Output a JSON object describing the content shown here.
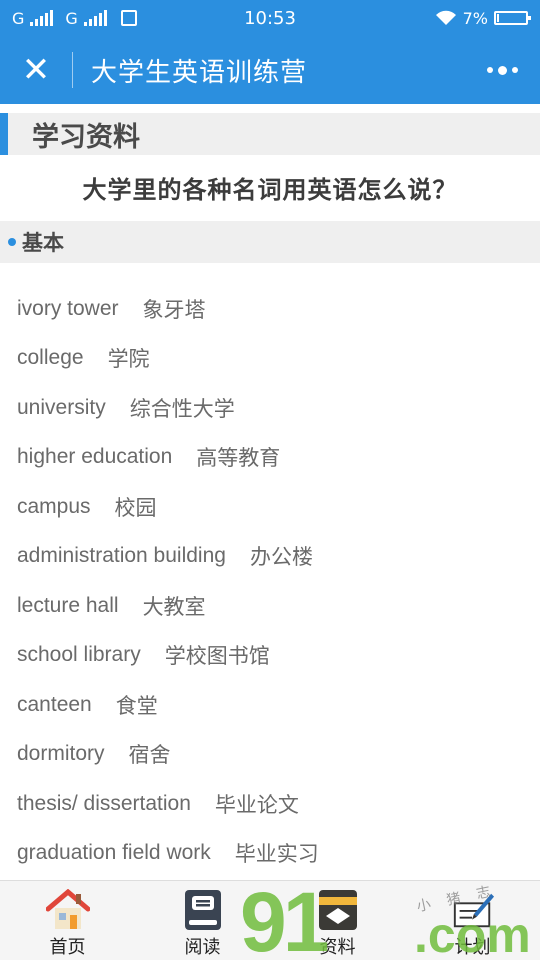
{
  "status_bar": {
    "carrier1": "G",
    "carrier2": "G",
    "time": "10:53",
    "battery_text": "7%",
    "battery_level": 0.07
  },
  "app_bar": {
    "close_label": "✕",
    "title": "大学生英语训练营"
  },
  "section": {
    "title": "学习资料"
  },
  "article": {
    "title": "大学里的各种名词用英语怎么说？"
  },
  "sub_section": {
    "title": "基本"
  },
  "vocab": [
    {
      "en": "ivory tower",
      "zh": "象牙塔"
    },
    {
      "en": "college",
      "zh": "学院"
    },
    {
      "en": "university",
      "zh": "综合性大学"
    },
    {
      "en": "higher education",
      "zh": "高等教育"
    },
    {
      "en": "campus",
      "zh": "校园"
    },
    {
      "en": "administration building",
      "zh": "办公楼"
    },
    {
      "en": "lecture hall",
      "zh": "大教室"
    },
    {
      "en": "school library",
      "zh": "学校图书馆"
    },
    {
      "en": "canteen",
      "zh": "食堂"
    },
    {
      "en": "dormitory",
      "zh": "宿舍"
    },
    {
      "en": "thesis/ dissertation",
      "zh": "毕业论文"
    },
    {
      "en": "graduation field work",
      "zh": "毕业实习"
    }
  ],
  "bottom_nav": {
    "items": [
      {
        "label": "首页",
        "icon": "home-icon"
      },
      {
        "label": "阅读",
        "icon": "book-icon"
      },
      {
        "label": "资料",
        "icon": "materials-icon"
      },
      {
        "label": "计划",
        "icon": "plan-icon"
      }
    ]
  },
  "watermark": {
    "big": "91",
    "com": ".com",
    "small": "小 猪 志"
  },
  "colors": {
    "accent": "#2b8fdf",
    "section_bg": "#efefef",
    "text": "#6a6a6a"
  }
}
